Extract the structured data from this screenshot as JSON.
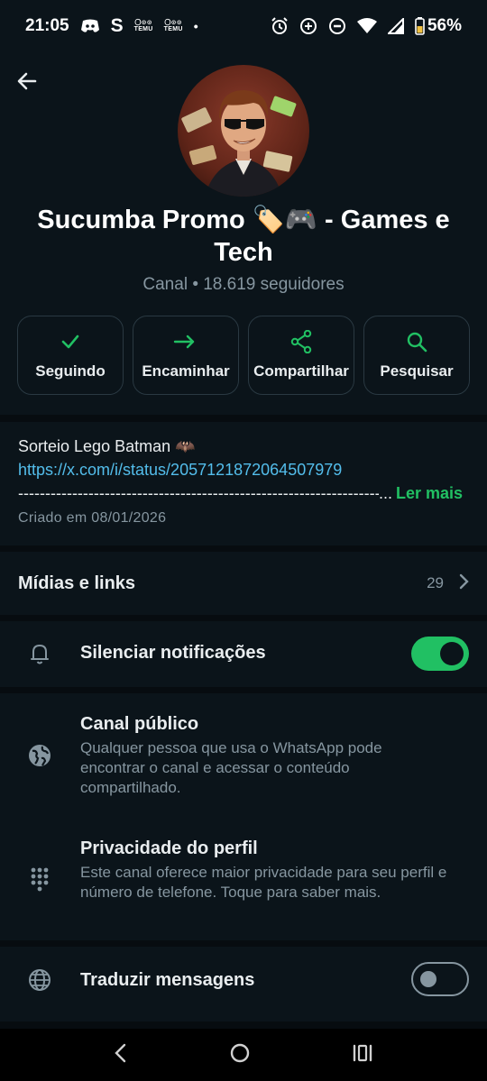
{
  "status_bar": {
    "time": "21:05",
    "s_label": "S",
    "temu1": [
      "〇⊙⊙",
      "TEMU"
    ],
    "temu2": [
      "〇⊙⊙",
      "TEMU"
    ],
    "dot": "•",
    "battery": "56%"
  },
  "channel": {
    "name": "Sucumba Promo 🏷️🎮  - Games e Tech",
    "meta": "Canal • 18.619 seguidores"
  },
  "actions": [
    {
      "label": "Seguindo",
      "icon": "check-icon"
    },
    {
      "label": "Encaminhar",
      "icon": "forward-icon"
    },
    {
      "label": "Compartilhar",
      "icon": "share-icon"
    },
    {
      "label": "Pesquisar",
      "icon": "search-icon"
    }
  ],
  "description": {
    "line1": "Sorteio Lego Batman 🦇",
    "link": "https://x.com/i/status/2057121872064507979",
    "dashes": "----------------------------------------------------------------------------",
    "ellipsis": "...",
    "read_more": "Ler mais",
    "created": "Criado em 08/01/2026"
  },
  "media": {
    "title": "Mídias e links",
    "count": "29"
  },
  "mute": {
    "title": "Silenciar notificações",
    "enabled": true
  },
  "public_channel": {
    "title": "Canal público",
    "subtitle": "Qualquer pessoa que usa o WhatsApp pode encontrar o canal e acessar o conteúdo compartilhado."
  },
  "privacy": {
    "title": "Privacidade do perfil",
    "subtitle": "Este canal oferece maior privacidade para seu perfil e número de telefone. Toque para saber mais."
  },
  "translate": {
    "title": "Traduzir mensagens",
    "enabled": false
  },
  "colors": {
    "accent": "#21c063",
    "link": "#53bdeb",
    "background": "#0b141a",
    "secondary_text": "#8696a0"
  }
}
